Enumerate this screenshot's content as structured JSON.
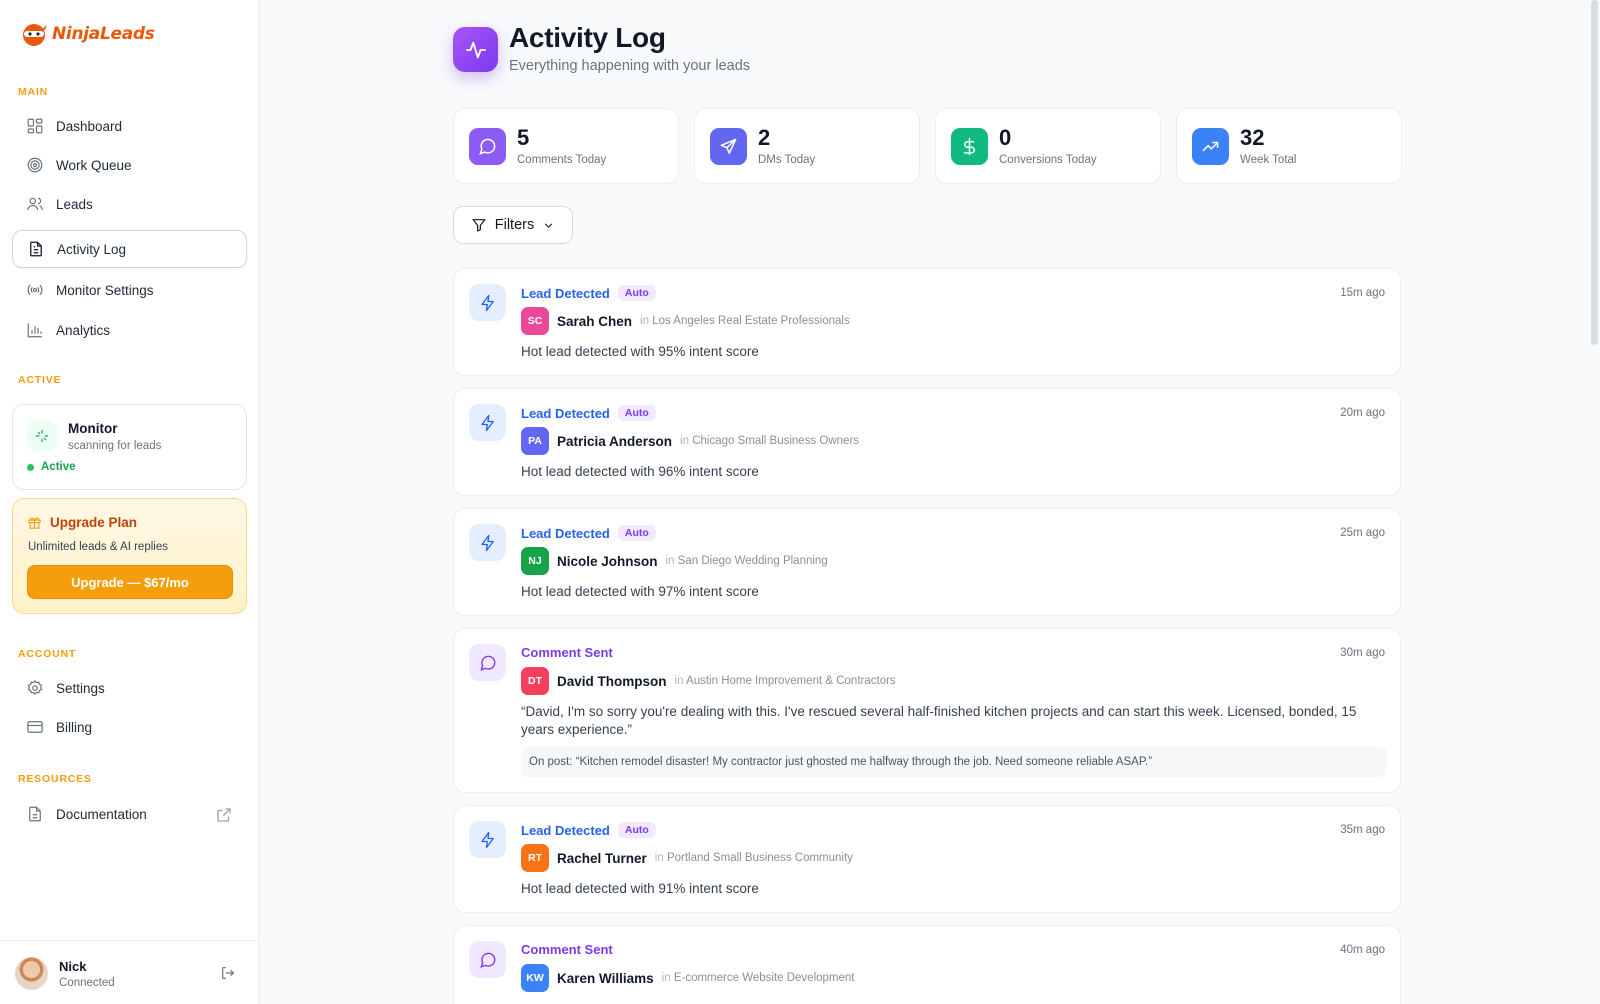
{
  "app": {
    "brand": "NinjaLeads",
    "accent": "#e8590c"
  },
  "sidebar": {
    "main_label": "MAIN",
    "main_items": [
      {
        "label": "Dashboard",
        "icon": "grid-icon"
      },
      {
        "label": "Work Queue",
        "icon": "target-icon"
      },
      {
        "label": "Leads",
        "icon": "users-icon"
      },
      {
        "label": "Activity Log",
        "icon": "document-icon",
        "active": true
      },
      {
        "label": "Monitor Settings",
        "icon": "broadcast-icon"
      },
      {
        "label": "Analytics",
        "icon": "bar-chart-icon"
      }
    ],
    "active_label": "ACTIVE",
    "monitor": {
      "title": "Monitor",
      "subtitle": "scanning for leads",
      "status": "Active"
    },
    "upgrade": {
      "title": "Upgrade Plan",
      "subtitle": "Unlimited leads & AI replies",
      "button": "Upgrade — $67/mo"
    },
    "account_label": "ACCOUNT",
    "account_items": [
      {
        "label": "Settings",
        "icon": "gear-icon"
      },
      {
        "label": "Billing",
        "icon": "credit-card-icon"
      }
    ],
    "resources_label": "RESOURCES",
    "resources_items": [
      {
        "label": "Documentation",
        "icon": "file-icon"
      }
    ],
    "user": {
      "name": "Nick",
      "status": "Connected"
    }
  },
  "header": {
    "title": "Activity Log",
    "subtitle": "Everything happening with your leads"
  },
  "stats": [
    {
      "value": "5",
      "label": "Comments Today",
      "color": "#8b5cf6"
    },
    {
      "value": "2",
      "label": "DMs Today",
      "color": "#6366f1"
    },
    {
      "value": "0",
      "label": "Conversions Today",
      "color": "#10b981"
    },
    {
      "value": "32",
      "label": "Week Total",
      "color": "#3b82f6"
    }
  ],
  "filters": {
    "label": "Filters"
  },
  "activities": [
    {
      "type": "Lead Detected",
      "kind": "lead",
      "badge": "Auto",
      "time": "15m ago",
      "initials": "SC",
      "initials_color": "#ec4899",
      "name": "Sarah Chen",
      "in": "in",
      "group": "Los Angeles Real Estate Professionals",
      "text": "Hot lead detected with 95% intent score"
    },
    {
      "type": "Lead Detected",
      "kind": "lead",
      "badge": "Auto",
      "time": "20m ago",
      "initials": "PA",
      "initials_color": "#6366f1",
      "name": "Patricia Anderson",
      "in": "in",
      "group": "Chicago Small Business Owners",
      "text": "Hot lead detected with 96% intent score"
    },
    {
      "type": "Lead Detected",
      "kind": "lead",
      "badge": "Auto",
      "time": "25m ago",
      "initials": "NJ",
      "initials_color": "#16a34a",
      "name": "Nicole Johnson",
      "in": "in",
      "group": "San Diego Wedding Planning",
      "text": "Hot lead detected with 97% intent score"
    },
    {
      "type": "Comment Sent",
      "kind": "comment",
      "time": "30m ago",
      "initials": "DT",
      "initials_color": "#f43f5e",
      "name": "David Thompson",
      "in": "in",
      "group": "Austin Home Improvement & Contractors",
      "quote": "“David, I'm so sorry you're dealing with this. I've rescued several half-finished kitchen projects and can start this week. Licensed, bonded, 15 years experience.”",
      "post": "On post: “Kitchen remodel disaster! My contractor just ghosted me halfway through the job. Need someone reliable ASAP.”"
    },
    {
      "type": "Lead Detected",
      "kind": "lead",
      "badge": "Auto",
      "time": "35m ago",
      "initials": "RT",
      "initials_color": "#f97316",
      "name": "Rachel Turner",
      "in": "in",
      "group": "Portland Small Business Community",
      "text": "Hot lead detected with 91% intent score"
    },
    {
      "type": "Comment Sent",
      "kind": "comment",
      "time": "40m ago",
      "initials": "KW",
      "initials_color": "#3b82f6",
      "name": "Karen Williams",
      "in": "in",
      "group": "E-commerce Website Development"
    }
  ]
}
